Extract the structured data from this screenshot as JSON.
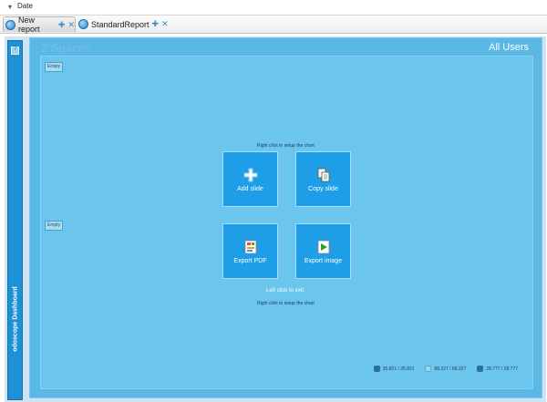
{
  "topbar": {
    "label": "Date"
  },
  "tabs": [
    {
      "label": "New report"
    },
    {
      "label": "StandardReport"
    }
  ],
  "sidebar": {
    "label": "odoscope Dashboard"
  },
  "main": {
    "spaces_label": "2 Spaces",
    "users_label": "All Users",
    "empty_top": "Empty",
    "empty_mid": "Empty",
    "hint_right_top": "Right click to setup the chart",
    "hint_left": "Left click to exit",
    "hint_right_bottom": "Right click to setup the chart",
    "tiles": [
      {
        "label": "Add slide",
        "icon": "add-icon"
      },
      {
        "label": "Copy slide",
        "icon": "copy-icon"
      },
      {
        "label": "Export PDF",
        "icon": "pdf-icon"
      },
      {
        "label": "Export image",
        "icon": "image-icon"
      }
    ]
  },
  "status": [
    {
      "text": "35.821 / 35.821"
    },
    {
      "text": "88.327 / 88.327"
    },
    {
      "text": "28.777 / 28.777"
    }
  ],
  "colors": {
    "sidebar": "#1e90d6",
    "main": "#5ab8e4",
    "canvas": "#6bc5ec",
    "tile": "#1e9ee6"
  }
}
